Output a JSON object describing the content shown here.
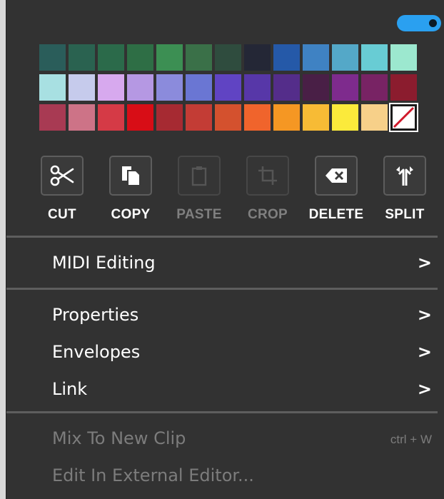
{
  "toggle": {
    "state": "on",
    "color": "#2aa0f0"
  },
  "palette": {
    "swatches": [
      "#2a5d5a",
      "#2a6250",
      "#2b6a4a",
      "#2e6e45",
      "#3c8f53",
      "#3a7048",
      "#2f4c3e",
      "#242736",
      "#2559a8",
      "#3f82c3",
      "#54a8c8",
      "#68ccd4",
      "#9ce8cf",
      "#a8e0e2",
      "#c6cbec",
      "#d7a9ee",
      "#b598e3",
      "#8b8bdc",
      "#6a76d3",
      "#6044c3",
      "#5737a8",
      "#542d8a",
      "#491f46",
      "#7e2b8d",
      "#782364",
      "#8b1c2e",
      "#a83a53",
      "#cd7387",
      "#d53a46",
      "#d80d16",
      "#a62a32",
      "#c33c35",
      "#d4512e",
      "#f0642c",
      "#f59723",
      "#f7bb35",
      "#fbea3b",
      "#f7d089",
      "none"
    ]
  },
  "tools": [
    {
      "id": "cut",
      "label": "CUT",
      "icon": "scissors-icon",
      "enabled": true
    },
    {
      "id": "copy",
      "label": "COPY",
      "icon": "copy-icon",
      "enabled": true
    },
    {
      "id": "paste",
      "label": "PASTE",
      "icon": "clipboard-icon",
      "enabled": false
    },
    {
      "id": "crop",
      "label": "CROP",
      "icon": "crop-icon",
      "enabled": false
    },
    {
      "id": "delete",
      "label": "DELETE",
      "icon": "backspace-icon",
      "enabled": true
    },
    {
      "id": "split",
      "label": "SPLIT",
      "icon": "split-icon",
      "enabled": true
    }
  ],
  "menu": {
    "midi_editing": {
      "label": "MIDI Editing",
      "chevron": ">"
    },
    "properties": {
      "label": "Properties",
      "chevron": ">"
    },
    "envelopes": {
      "label": "Envelopes",
      "chevron": ">"
    },
    "link": {
      "label": "Link",
      "chevron": ">"
    },
    "mix_to_new_clip": {
      "label": "Mix To New Clip",
      "shortcut": "ctrl + W"
    },
    "edit_external": {
      "label": "Edit In External Editor..."
    }
  }
}
